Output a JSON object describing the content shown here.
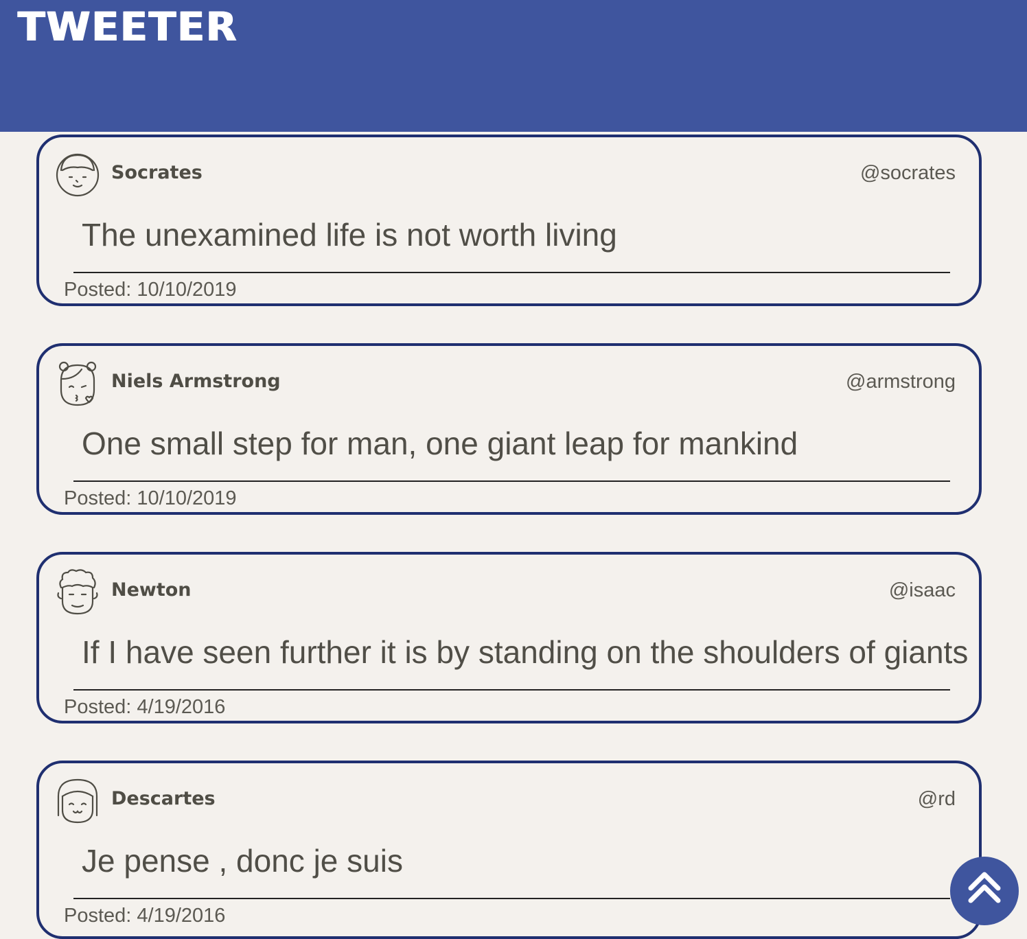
{
  "header": {
    "logo": "TWEETER"
  },
  "tweets": [
    {
      "name": "Socrates",
      "handle": "@socrates",
      "text": "The unexamined life is not worth living",
      "posted": "Posted: 10/10/2019",
      "avatar_icon": "man-face-avatar-icon"
    },
    {
      "name": "Niels Armstrong",
      "handle": "@armstrong",
      "text": "One small step for man, one giant leap for mankind",
      "posted": "Posted: 10/10/2019",
      "avatar_icon": "girl-kiss-avatar-icon"
    },
    {
      "name": "Newton",
      "handle": "@isaac",
      "text": "If I have seen further it is by standing on the shoulders of giants",
      "posted": "Posted: 4/19/2016",
      "avatar_icon": "curly-hair-avatar-icon"
    },
    {
      "name": "Descartes",
      "handle": "@rd",
      "text": "Je pense , donc je suis",
      "posted": "Posted: 4/19/2016",
      "avatar_icon": "bob-hair-avatar-icon"
    }
  ],
  "colors": {
    "header_bg": "#3f559e",
    "page_bg": "#f4f1ed",
    "card_border": "#1f2f70",
    "text": "#55534c"
  },
  "scroll_top_icon": "double-chevron-up-icon"
}
